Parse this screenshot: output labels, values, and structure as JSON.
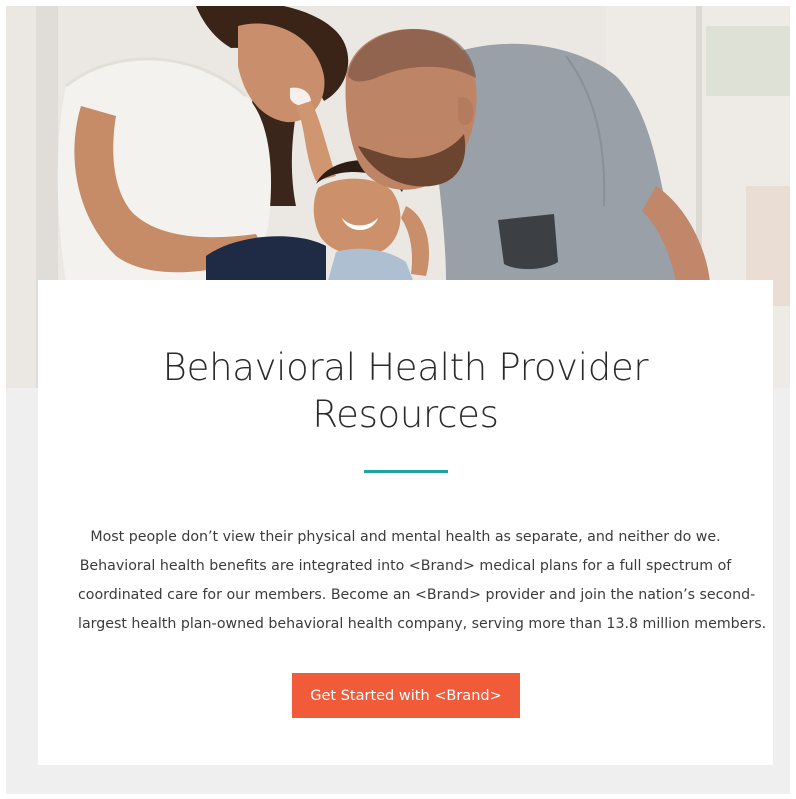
{
  "hero": {
    "image_alt": "Family laughing together: mother, father and young child"
  },
  "card": {
    "title_line_1": "Behavioral Health Provider",
    "title_line_2": "Resources",
    "body_lines": [
      "Most people don’t view their physical and mental health as separate, and neither do we.",
      "Behavioral health benefits are integrated into <Brand> medical plans for a full spectrum of",
      "coordinated care for our members. Become an <Brand> provider and join the nation’s second-",
      "largest health plan-owned behavioral health company, serving more than 13.8 million members."
    ],
    "cta_label": "Get Started with <Brand>"
  },
  "colors": {
    "accent_rule": "#1ea3a3",
    "cta_background": "#f15b3a",
    "page_background": "#efefef",
    "card_background": "#ffffff"
  }
}
